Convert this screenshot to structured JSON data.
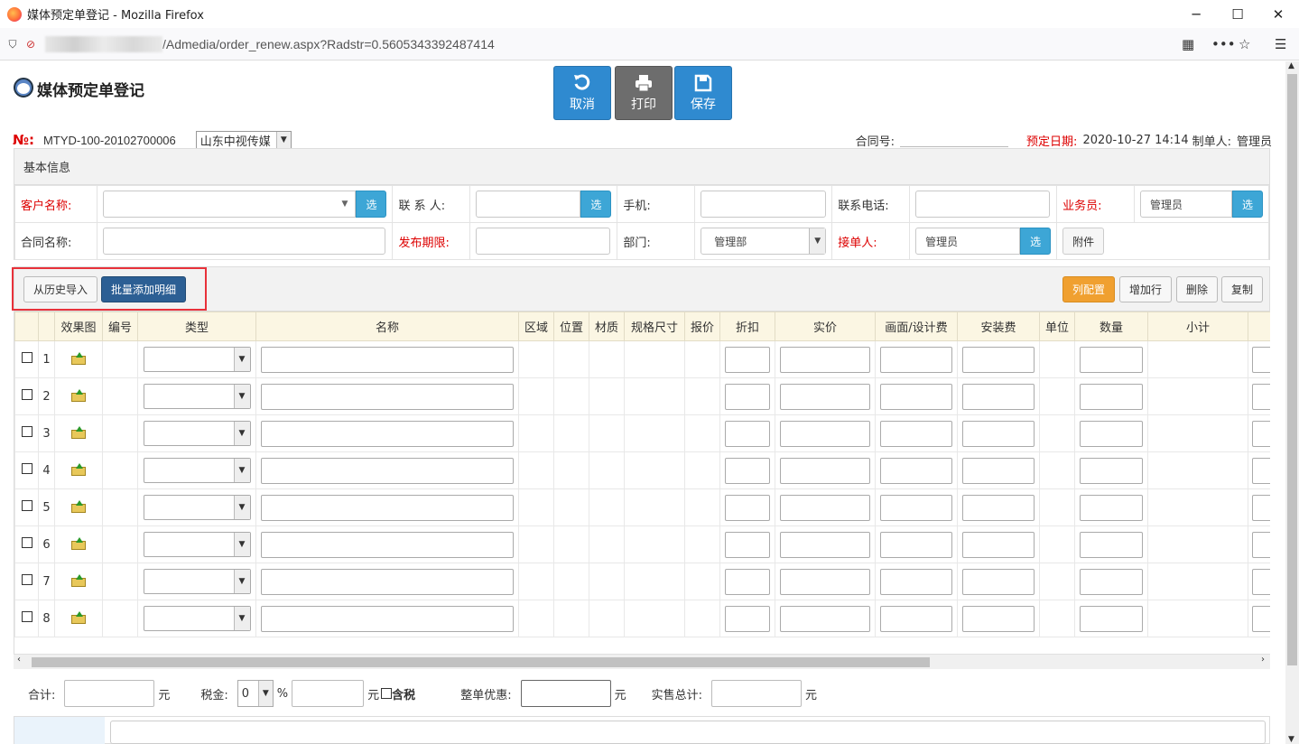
{
  "window": {
    "title": "媒体预定单登记 - Mozilla Firefox"
  },
  "url": {
    "text": "/Admedia/order_renew.aspx?Radstr=0.5605343392487414"
  },
  "page": {
    "title": "媒体预定单登记"
  },
  "top_buttons": {
    "cancel": "取消",
    "print": "打印",
    "save": "保存"
  },
  "order": {
    "no_label": "№:",
    "no_value": "MTYD-100-20102700006",
    "company": "山东中视传媒",
    "contract_label": "合同号:",
    "date_label": "预定日期:",
    "date_value": "2020-10-27 14:14",
    "maker_label": "制单人:",
    "maker_value": "管理员"
  },
  "basic": {
    "heading": "基本信息",
    "customer_label": "客户名称:",
    "contact_label": "联 系 人:",
    "mobile_label": "手机:",
    "phone_label": "联系电话:",
    "salesman_label": "业务员:",
    "salesman_value": "管理员",
    "contract_name_label": "合同名称:",
    "period_label": "发布期限:",
    "dept_label": "部门:",
    "dept_value": "管理部",
    "receiver_label": "接单人:",
    "receiver_value": "管理员",
    "pick": "选",
    "attach": "附件"
  },
  "toolbar": {
    "import_history": "从历史导入",
    "batch_add": "批量添加明细",
    "col_config": "列配置",
    "add_row": "增加行",
    "delete": "删除",
    "copy": "复制"
  },
  "grid": {
    "headers": [
      "效果图",
      "编号",
      "类型",
      "名称",
      "区域",
      "位置",
      "材质",
      "规格尺寸",
      "报价",
      "折扣",
      "实价",
      "画面/设计费",
      "安装费",
      "单位",
      "数量",
      "小计"
    ],
    "rows": [
      "1",
      "2",
      "3",
      "4",
      "5",
      "6",
      "7",
      "8"
    ]
  },
  "totals": {
    "total_label": "合计:",
    "yuan": "元",
    "tax_label": "税金:",
    "tax_value": "0",
    "percent": "%",
    "tax_included": "含税",
    "discount_label": "整单优惠:",
    "sale_total_label": "实售总计:"
  },
  "colors": {
    "accent_blue": "#2f8ad0",
    "required_red": "#dd0000",
    "highlight_box": "#e8313a",
    "orange_button": "#f0a030"
  }
}
